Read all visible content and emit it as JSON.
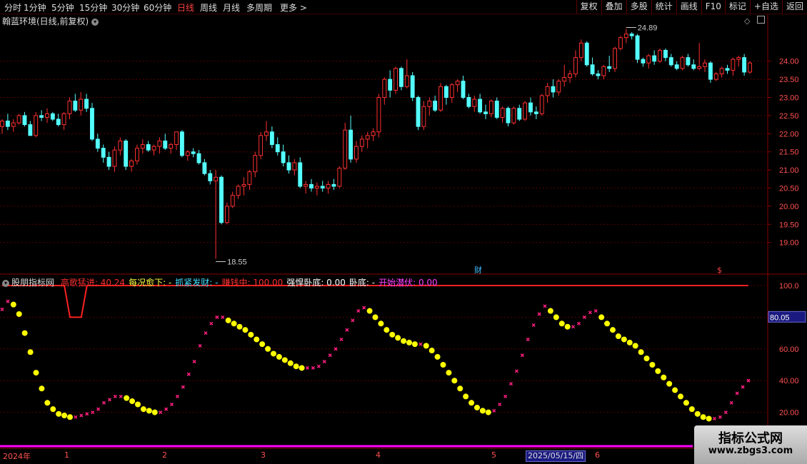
{
  "toolbar": {
    "periods": [
      "分时",
      "1分钟",
      "5分钟",
      "15分钟",
      "30分钟",
      "60分钟",
      "日线",
      "周线",
      "月线",
      "多周期",
      "更多 >"
    ],
    "active_period": "日线",
    "buttons": [
      "复权",
      "叠加",
      "多股",
      "统计",
      "画线",
      "F10",
      "标记",
      "+自选",
      "返回"
    ]
  },
  "main_chart": {
    "title": "翰蓝环境(日线,前复权)",
    "high_label": "24.89",
    "low_label": "18.55",
    "y_ticks": [
      "24.00",
      "23.50",
      "23.00",
      "22.50",
      "22.00",
      "21.50",
      "21.00",
      "20.50",
      "20.00",
      "19.50",
      "19.00"
    ],
    "y_range": [
      18.6,
      24.9
    ],
    "markers": {
      "cai": "财",
      "dollar": "$"
    }
  },
  "indicator": {
    "name": "股朋指标网",
    "items": [
      {
        "label": "高歌猛进:",
        "value": "40.24",
        "color": "#ff3030"
      },
      {
        "label": "每况愈下:",
        "value": "-",
        "color": "#ffff40"
      },
      {
        "label": "抓紧发财:",
        "value": "-",
        "color": "#40e0ff"
      },
      {
        "label": "赚钱中:",
        "value": "100.00",
        "color": "#ff3030"
      },
      {
        "label": "强悍卧底:",
        "value": "0.00",
        "color": "#ffffff"
      },
      {
        "label": "卧底:",
        "value": "-",
        "color": "#ffffff"
      },
      {
        "label": "开始潜伏:",
        "value": "0.00",
        "color": "#ff40ff"
      }
    ],
    "y_ticks": [
      "100.0",
      "80.00",
      "60.00",
      "40.00",
      "20.00"
    ],
    "current_value": "80.05",
    "y_range": [
      0,
      100
    ]
  },
  "x_axis": {
    "labels": [
      "2024年",
      "1",
      "2",
      "3",
      "4",
      "5",
      "6"
    ],
    "selected_date": "2025/05/15/四"
  },
  "watermark": {
    "title": "指标公式网",
    "url": "www.zbgs3.com"
  },
  "colors": {
    "up": "#ff3030",
    "down": "#54ffff",
    "yellow": "#ffff00",
    "pink": "#ff2080",
    "magenta": "#ff00ff"
  },
  "chart_data": [
    {
      "type": "candlestick",
      "title": "翰蓝环境(日线,前复权)",
      "ohlc": [
        [
          22.2,
          22.4,
          22.0,
          22.35
        ],
        [
          22.35,
          22.55,
          22.1,
          22.2
        ],
        [
          22.2,
          22.4,
          22.05,
          22.3
        ],
        [
          22.3,
          22.55,
          22.25,
          22.5
        ],
        [
          22.5,
          22.6,
          22.2,
          22.25
        ],
        [
          22.25,
          22.35,
          21.95,
          21.95
        ],
        [
          21.95,
          22.6,
          21.9,
          22.5
        ],
        [
          22.5,
          22.65,
          22.35,
          22.45
        ],
        [
          22.45,
          22.7,
          22.3,
          22.55
        ],
        [
          22.55,
          22.6,
          22.35,
          22.4
        ],
        [
          22.4,
          22.55,
          22.2,
          22.25
        ],
        [
          22.25,
          22.6,
          22.1,
          22.55
        ],
        [
          22.55,
          23.0,
          22.4,
          22.9
        ],
        [
          22.9,
          23.1,
          22.6,
          22.65
        ],
        [
          22.65,
          23.15,
          22.5,
          22.95
        ],
        [
          22.95,
          23.1,
          22.6,
          22.7
        ],
        [
          22.7,
          22.85,
          21.8,
          21.85
        ],
        [
          21.85,
          22.0,
          21.5,
          21.6
        ],
        [
          21.6,
          21.7,
          21.2,
          21.35
        ],
        [
          21.35,
          21.5,
          21.0,
          21.1
        ],
        [
          21.1,
          21.65,
          20.95,
          21.55
        ],
        [
          21.55,
          21.9,
          21.4,
          21.8
        ],
        [
          21.8,
          21.85,
          21.0,
          21.1
        ],
        [
          21.1,
          21.3,
          20.95,
          21.25
        ],
        [
          21.25,
          21.7,
          21.15,
          21.6
        ],
        [
          21.6,
          21.85,
          21.45,
          21.7
        ],
        [
          21.7,
          21.8,
          21.5,
          21.55
        ],
        [
          21.55,
          21.7,
          21.4,
          21.65
        ],
        [
          21.65,
          21.9,
          21.45,
          21.8
        ],
        [
          21.8,
          22.0,
          21.55,
          21.6
        ],
        [
          21.6,
          21.75,
          21.45,
          21.7
        ],
        [
          21.7,
          22.05,
          21.55,
          22.05
        ],
        [
          22.05,
          22.1,
          21.35,
          21.4
        ],
        [
          21.4,
          21.55,
          21.25,
          21.5
        ],
        [
          21.5,
          21.6,
          21.35,
          21.45
        ],
        [
          21.45,
          21.55,
          21.15,
          21.2
        ],
        [
          21.2,
          21.3,
          20.85,
          20.9
        ],
        [
          20.9,
          21.0,
          20.6,
          20.7
        ],
        [
          20.7,
          21.0,
          18.55,
          20.8
        ],
        [
          20.8,
          20.85,
          19.5,
          19.55
        ],
        [
          19.55,
          20.1,
          19.5,
          20.0
        ],
        [
          20.0,
          20.4,
          19.95,
          20.3
        ],
        [
          20.3,
          20.6,
          20.2,
          20.55
        ],
        [
          20.55,
          20.8,
          20.3,
          20.6
        ],
        [
          20.6,
          21.0,
          20.45,
          20.95
        ],
        [
          20.95,
          21.5,
          20.8,
          21.4
        ],
        [
          21.4,
          22.05,
          21.3,
          21.95
        ],
        [
          21.95,
          22.35,
          21.8,
          22.05
        ],
        [
          22.05,
          22.2,
          21.6,
          21.7
        ],
        [
          21.7,
          21.9,
          21.4,
          21.5
        ],
        [
          21.5,
          21.7,
          21.1,
          21.2
        ],
        [
          21.2,
          21.4,
          20.9,
          21.0
        ],
        [
          21.0,
          21.3,
          20.85,
          21.2
        ],
        [
          21.2,
          21.35,
          20.5,
          20.55
        ],
        [
          20.55,
          20.7,
          20.35,
          20.6
        ],
        [
          20.6,
          20.75,
          20.4,
          20.5
        ],
        [
          20.5,
          20.65,
          20.3,
          20.55
        ],
        [
          20.55,
          20.7,
          20.4,
          20.5
        ],
        [
          20.5,
          20.7,
          20.35,
          20.6
        ],
        [
          20.6,
          20.75,
          20.45,
          20.55
        ],
        [
          20.55,
          21.1,
          20.5,
          21.05
        ],
        [
          21.05,
          22.3,
          21.0,
          22.1
        ],
        [
          22.1,
          22.5,
          21.2,
          21.3
        ],
        [
          21.3,
          21.8,
          21.2,
          21.65
        ],
        [
          21.65,
          21.95,
          21.5,
          21.85
        ],
        [
          21.85,
          22.05,
          21.6,
          21.95
        ],
        [
          21.95,
          22.15,
          21.8,
          22.05
        ],
        [
          22.05,
          23.1,
          21.9,
          23.0
        ],
        [
          23.0,
          23.55,
          22.8,
          23.5
        ],
        [
          23.5,
          23.75,
          23.0,
          23.2
        ],
        [
          23.2,
          23.85,
          23.1,
          23.8
        ],
        [
          23.8,
          23.85,
          23.2,
          23.3
        ],
        [
          23.3,
          24.05,
          23.25,
          23.6
        ],
        [
          23.6,
          23.7,
          22.9,
          23.0
        ],
        [
          23.0,
          23.05,
          22.1,
          22.2
        ],
        [
          22.2,
          22.9,
          22.1,
          22.75
        ],
        [
          22.75,
          23.0,
          22.5,
          22.9
        ],
        [
          22.9,
          23.05,
          22.6,
          22.65
        ],
        [
          22.65,
          23.4,
          22.6,
          23.3
        ],
        [
          23.3,
          23.35,
          22.8,
          23.0
        ],
        [
          23.0,
          23.4,
          22.85,
          23.35
        ],
        [
          23.35,
          23.5,
          23.15,
          23.45
        ],
        [
          23.45,
          23.6,
          22.95,
          23.0
        ],
        [
          23.0,
          23.1,
          22.7,
          22.75
        ],
        [
          22.75,
          23.05,
          22.6,
          22.95
        ],
        [
          22.95,
          23.1,
          22.55,
          22.6
        ],
        [
          22.6,
          22.8,
          22.4,
          22.55
        ],
        [
          22.55,
          22.95,
          22.45,
          22.9
        ],
        [
          22.9,
          23.0,
          22.4,
          22.45
        ],
        [
          22.45,
          22.75,
          22.3,
          22.7
        ],
        [
          22.7,
          22.75,
          22.2,
          22.3
        ],
        [
          22.3,
          22.75,
          22.25,
          22.7
        ],
        [
          22.7,
          22.8,
          22.35,
          22.4
        ],
        [
          22.4,
          22.9,
          22.35,
          22.85
        ],
        [
          22.85,
          23.0,
          22.5,
          22.6
        ],
        [
          22.6,
          22.75,
          22.4,
          22.55
        ],
        [
          22.55,
          23.1,
          22.5,
          23.05
        ],
        [
          23.05,
          23.4,
          22.85,
          23.3
        ],
        [
          23.3,
          23.5,
          23.0,
          23.15
        ],
        [
          23.15,
          23.5,
          23.05,
          23.45
        ],
        [
          23.45,
          23.9,
          23.3,
          23.55
        ],
        [
          23.55,
          23.75,
          23.4,
          23.65
        ],
        [
          23.65,
          24.3,
          23.55,
          24.1
        ],
        [
          24.1,
          24.6,
          24.0,
          24.5
        ],
        [
          24.5,
          24.55,
          23.85,
          23.9
        ],
        [
          23.9,
          24.1,
          23.6,
          23.65
        ],
        [
          23.65,
          23.75,
          23.5,
          23.6
        ],
        [
          23.6,
          23.9,
          23.5,
          23.85
        ],
        [
          23.85,
          24.15,
          23.7,
          23.8
        ],
        [
          23.8,
          24.4,
          23.7,
          24.35
        ],
        [
          24.35,
          24.7,
          24.3,
          24.65
        ],
        [
          24.65,
          24.89,
          24.5,
          24.75
        ],
        [
          24.75,
          24.8,
          24.6,
          24.7
        ],
        [
          24.7,
          24.75,
          23.95,
          24.05
        ],
        [
          24.05,
          24.1,
          23.85,
          23.95
        ],
        [
          23.95,
          24.2,
          23.8,
          24.15
        ],
        [
          24.15,
          24.3,
          23.9,
          24.0
        ],
        [
          24.0,
          24.35,
          23.95,
          24.3
        ],
        [
          24.3,
          24.35,
          24.0,
          24.1
        ],
        [
          24.1,
          24.2,
          23.85,
          23.9
        ],
        [
          23.9,
          24.0,
          23.75,
          23.8
        ],
        [
          23.8,
          24.15,
          23.75,
          24.1
        ],
        [
          24.1,
          24.2,
          23.85,
          23.9
        ],
        [
          23.9,
          24.05,
          23.75,
          23.8
        ],
        [
          23.8,
          24.5,
          23.75,
          23.85
        ],
        [
          23.85,
          24.05,
          23.7,
          23.95
        ],
        [
          23.95,
          24.0,
          23.4,
          23.5
        ],
        [
          23.5,
          23.7,
          23.45,
          23.65
        ],
        [
          23.65,
          23.85,
          23.55,
          23.8
        ],
        [
          23.8,
          23.9,
          23.65,
          23.75
        ],
        [
          23.75,
          24.1,
          23.6,
          24.05
        ],
        [
          24.05,
          24.15,
          23.85,
          24.1
        ],
        [
          24.1,
          24.2,
          23.6,
          23.7
        ],
        [
          23.7,
          24.0,
          23.65,
          23.95
        ]
      ]
    },
    {
      "type": "line",
      "title": "股朋指标网",
      "series": [
        {
          "name": "高歌猛进",
          "values": [
            85,
            90,
            88,
            82,
            70,
            58,
            45,
            35,
            26,
            22,
            19,
            18,
            17,
            17,
            18,
            19,
            20,
            22,
            26,
            28,
            30,
            30,
            29,
            27,
            25,
            22,
            21,
            20,
            20,
            22,
            25,
            30,
            36,
            44,
            52,
            62,
            70,
            76,
            80,
            80,
            78,
            76,
            74,
            72,
            69,
            66,
            63,
            60,
            57,
            55,
            53,
            51,
            49,
            48,
            48,
            48,
            49,
            52,
            56,
            60,
            66,
            72,
            78,
            84,
            86,
            84,
            80,
            76,
            72,
            69,
            67,
            65,
            64,
            63,
            63,
            62,
            59,
            55,
            50,
            45,
            40,
            35,
            30,
            26,
            23,
            21,
            20,
            21,
            25,
            30,
            38,
            46,
            56,
            66,
            75,
            82,
            87,
            84,
            80,
            76,
            74,
            74,
            76,
            80,
            83,
            84,
            80,
            76,
            72,
            68,
            66,
            64,
            62,
            58,
            54,
            50,
            46,
            42,
            38,
            34,
            30,
            26,
            22,
            19,
            17,
            16,
            16,
            17,
            20,
            26,
            32,
            36,
            40
          ]
        },
        {
          "name": "赚钱中",
          "values": [
            100,
            100,
            100,
            100,
            100,
            100,
            100,
            100,
            100,
            100,
            100,
            100,
            80,
            80,
            80,
            100,
            100,
            100,
            100,
            100,
            100,
            100,
            100,
            100,
            100,
            100,
            100,
            100,
            100,
            100,
            100,
            100,
            100,
            100,
            100,
            100,
            100,
            100,
            100,
            100,
            100,
            100,
            100,
            100,
            100,
            100,
            100,
            100,
            100,
            100,
            100,
            100,
            100,
            100,
            100,
            100,
            100,
            100,
            100,
            100,
            100,
            100,
            100,
            100,
            100,
            100,
            100,
            100,
            100,
            100,
            100,
            100,
            100,
            100,
            100,
            100,
            100,
            100,
            100,
            100,
            100,
            100,
            100,
            100,
            100,
            100,
            100,
            100,
            100,
            100,
            100,
            100,
            100,
            100,
            100,
            100,
            100,
            100,
            100,
            100,
            100,
            100,
            100,
            100,
            100,
            100,
            100,
            100,
            100,
            100,
            100,
            100,
            100,
            100,
            100,
            100,
            100,
            100,
            100,
            100,
            100,
            100,
            100,
            100,
            100,
            100,
            100,
            100,
            100,
            100,
            100,
            100,
            100
          ]
        }
      ],
      "ylim": [
        0,
        100
      ]
    }
  ]
}
